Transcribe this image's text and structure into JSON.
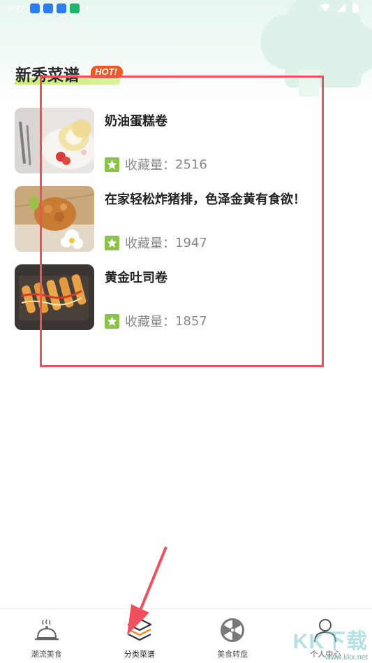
{
  "status_bar": {
    "time": "9:27",
    "notification_icons": [
      "blue",
      "blue",
      "blue",
      "green"
    ]
  },
  "section": {
    "title": "新秀菜谱",
    "badge": "HOT!"
  },
  "recipes": [
    {
      "title": "奶油蛋糕卷",
      "fav_label": "收藏量：",
      "fav_count": "2516",
      "image": "cake-roll-photo"
    },
    {
      "title": "在家轻松炸猪排，色泽金黄有食欲！",
      "fav_label": "收藏量：",
      "fav_count": "1947",
      "image": "fried-pork-cutlet-photo"
    },
    {
      "title": "黄金吐司卷",
      "fav_label": "收藏量：",
      "fav_count": "1857",
      "image": "toast-roll-photo"
    }
  ],
  "bottom_nav": [
    {
      "label": "潮流美食",
      "icon": "cloche-icon",
      "active": false
    },
    {
      "label": "分类菜谱",
      "icon": "layers-icon",
      "active": true
    },
    {
      "label": "美食转盘",
      "icon": "wheel-icon",
      "active": false
    },
    {
      "label": "个人中心",
      "icon": "person-icon",
      "active": false
    }
  ],
  "colors": {
    "accent_green": "#8bc34a",
    "badge_orange": "#f2571f",
    "highlight_red": "#f0505e",
    "active_orange": "#f08a2a"
  },
  "watermark": {
    "text": "KK下载",
    "url": "www.kkx.net"
  }
}
